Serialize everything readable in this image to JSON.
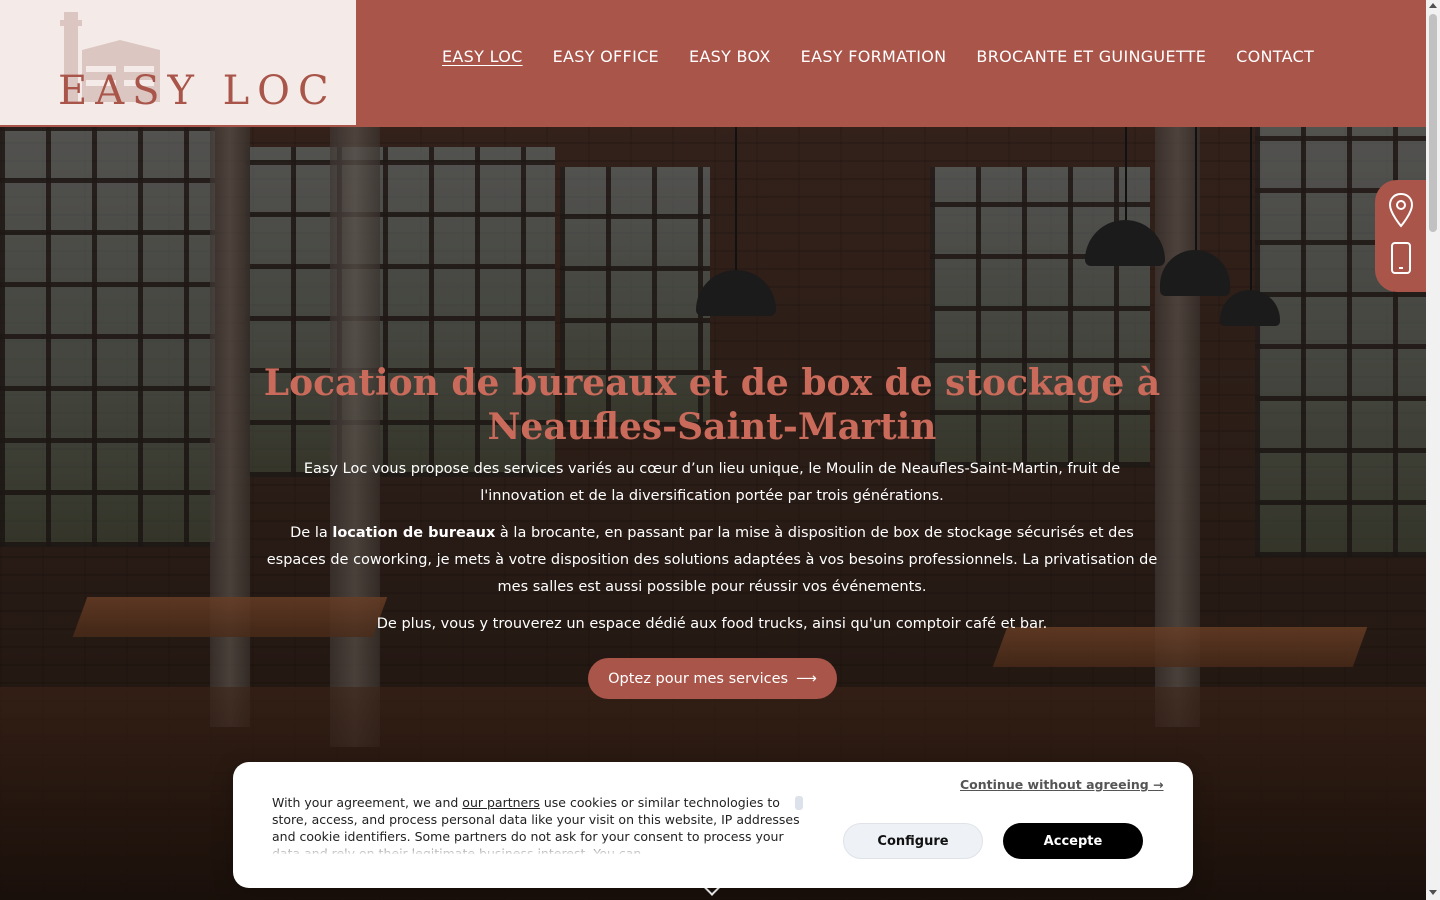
{
  "logo": {
    "text": "EASY LOC"
  },
  "nav": {
    "items": [
      {
        "label": "EASY LOC",
        "active": true
      },
      {
        "label": "EASY OFFICE"
      },
      {
        "label": "EASY BOX"
      },
      {
        "label": "EASY FORMATION"
      },
      {
        "label": "BROCANTE ET GUINGUETTE"
      },
      {
        "label": "CONTACT"
      }
    ]
  },
  "hero": {
    "title": "Location de bureaux et de box de stockage à Neaufles-Saint-Martin",
    "p1": "Easy Loc vous propose des services variés au cœur d’un lieu unique, le Moulin de Neaufles-Saint-Martin, fruit de l'innovation et de la diversification portée par trois générations.",
    "p2_before": "De la ",
    "p2_bold": "location de bureaux",
    "p2_after": " à la brocante, en passant par la mise à disposition de box de stockage sécurisés et des espaces de coworking, je mets à votre disposition des solutions adaptées à vos besoins professionnels. La privatisation de mes salles est aussi possible pour réussir vos événements.",
    "p3": "De plus, vous y trouverez un espace dédié aux food trucks, ainsi qu'un comptoir café et bar.",
    "cta_label": "Optez pour mes services",
    "cta_arrow": "⟶"
  },
  "side_tab": {
    "icons": [
      "map-pin-icon",
      "phone-icon"
    ]
  },
  "cookie": {
    "text_before": "With your agreement, we and ",
    "partners_link": "our partners",
    "text_after": " use cookies or similar technologies to store, access, and process personal data like your visit on this website, IP addresses and cookie identifiers. Some partners do not ask for your consent to process your data and rely on their legitimate business interest. You can",
    "continue_label": "Continue without agreeing →",
    "configure_label": "Configure",
    "accept_label": "Accepte"
  },
  "colors": {
    "brand": "#a9554a",
    "logo_bg": "#f4ebe8",
    "title": "#c96a5a"
  }
}
